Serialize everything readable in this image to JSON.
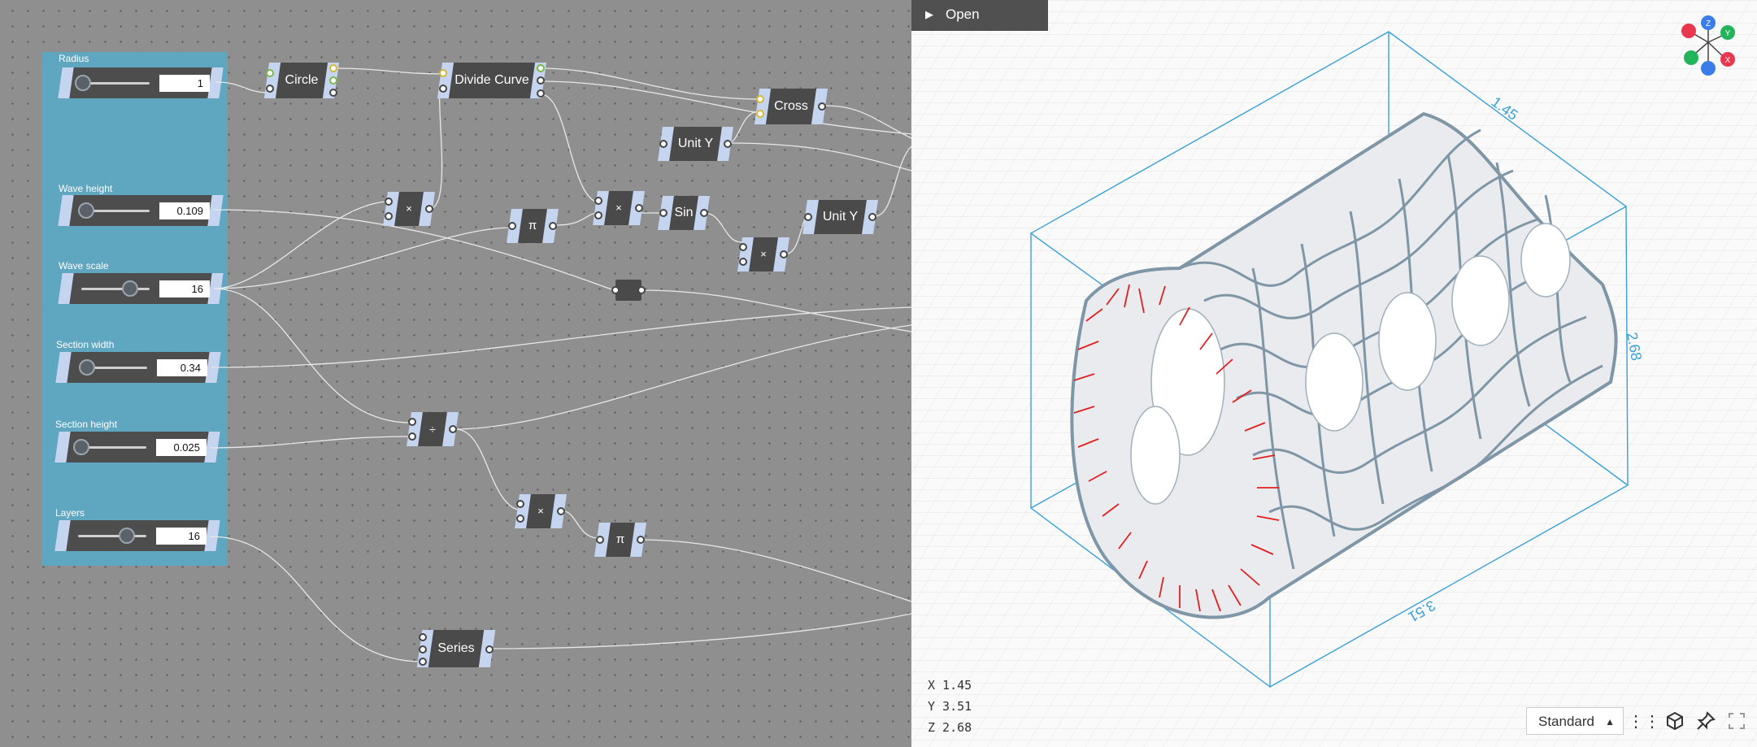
{
  "sliders": [
    {
      "label": "Radius",
      "value": "1",
      "knob": 0.1
    },
    {
      "label": "Wave height",
      "value": "0.109",
      "knob": 0.15
    },
    {
      "label": "Wave scale",
      "value": "16",
      "knob": 0.8
    },
    {
      "label": "Section width",
      "value": "0.34",
      "knob": 0.2
    },
    {
      "label": "Section height",
      "value": "0.025",
      "knob": 0.05
    },
    {
      "label": "Layers",
      "value": "16",
      "knob": 0.8
    }
  ],
  "nodes": {
    "circle": "Circle",
    "divide_curve": "Divide Curve",
    "cross": "Cross",
    "unit_y_1": "Unit Y",
    "unit_y_2": "Unit Y",
    "sin": "Sin",
    "multiply_1": "×",
    "multiply_2": "×",
    "multiply_3": "×",
    "multiply_4": "×",
    "pi_1": "π",
    "pi_2": "π",
    "divide": "÷",
    "series": "Series"
  },
  "viewport": {
    "open_label": "Open",
    "dims": {
      "top": "1.45",
      "right": "2.68",
      "bottom": "3.51"
    },
    "coords": {
      "x": "X 1.45",
      "y": "Y 3.51",
      "z": "Z 2.68"
    },
    "mode": "Standard",
    "gizmo": {
      "z": "Z",
      "y": "Y",
      "x": "X"
    }
  },
  "colors": {
    "group": "#5da8c4",
    "node": "#4a4a4a",
    "port_ends": "#c5d5f0",
    "box": "#3aa0d8",
    "normals": "#e02020"
  },
  "icons": [
    "chevron-right-icon",
    "grip-icon",
    "cube-icon",
    "pin-icon",
    "fullscreen-icon"
  ]
}
